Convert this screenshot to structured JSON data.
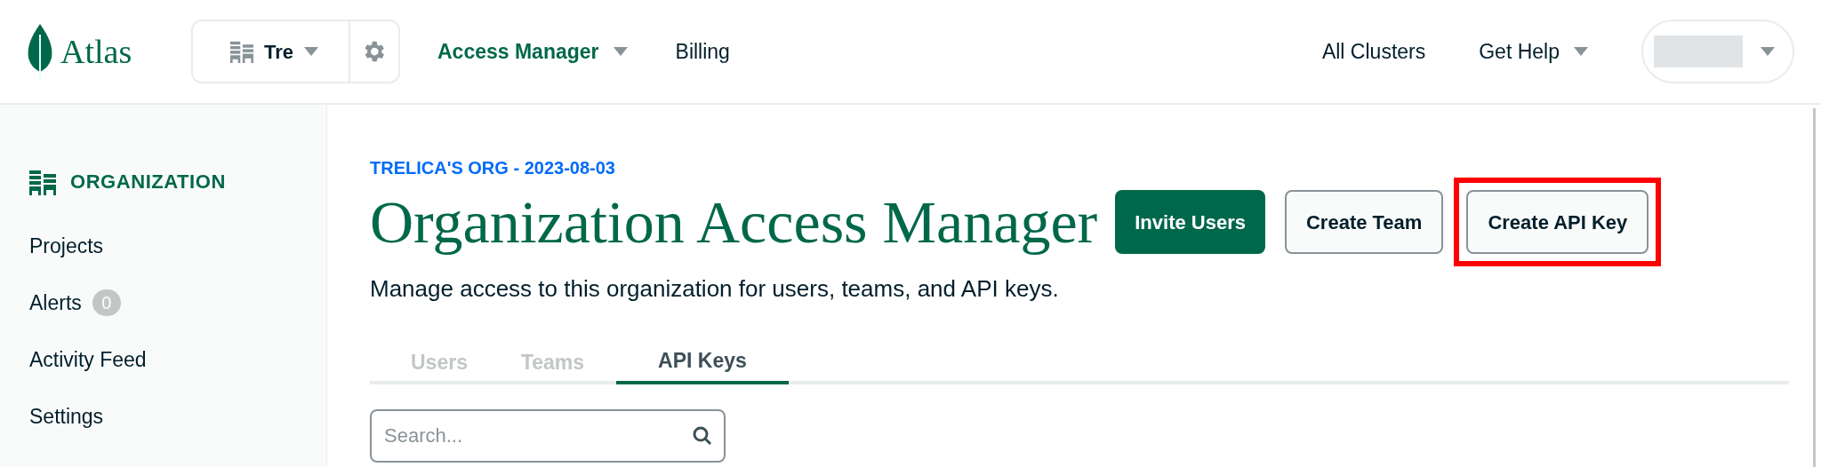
{
  "top_bar": {
    "logo": "Atlas",
    "org_selector": {
      "label": "Tre"
    },
    "nav": [
      {
        "label": "Access Manager",
        "selected": true,
        "dropdown": true
      },
      {
        "label": "Billing",
        "selected": false,
        "dropdown": false
      }
    ],
    "right_links": [
      {
        "label": "All Clusters",
        "dropdown": false
      },
      {
        "label": "Get Help",
        "dropdown": true
      }
    ]
  },
  "sidebar": {
    "heading": "ORGANIZATION",
    "items": [
      {
        "label": "Projects"
      },
      {
        "label": "Alerts",
        "badge": "0"
      },
      {
        "label": "Activity Feed"
      },
      {
        "label": "Settings"
      }
    ]
  },
  "main": {
    "breadcrumb": "TRELICA'S ORG - 2023-08-03",
    "title": "Organization Access Manager",
    "description": "Manage access to this organization for users, teams, and API keys.",
    "buttons": [
      {
        "label": "Invite Users",
        "kind": "primary",
        "highlighted": false
      },
      {
        "label": "Create Team",
        "kind": "secondary",
        "highlighted": false
      },
      {
        "label": "Create API Key",
        "kind": "secondary",
        "highlighted": true
      }
    ],
    "tabs": [
      {
        "label": "Users",
        "selected": false
      },
      {
        "label": "Teams",
        "selected": false
      },
      {
        "label": "API Keys",
        "selected": true
      }
    ],
    "search": {
      "placeholder": "Search..."
    }
  }
}
